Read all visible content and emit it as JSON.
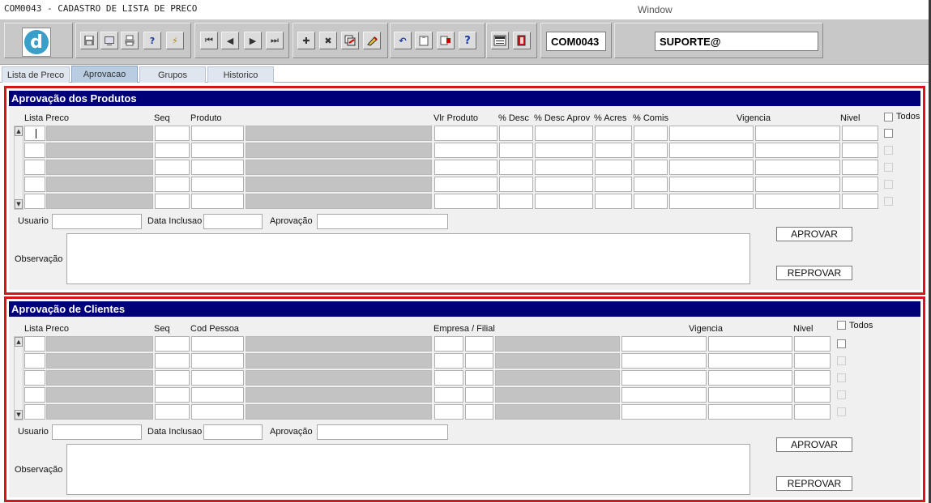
{
  "window": {
    "title": "COM0043 - CADASTRO DE LISTA DE PRECO",
    "menu_label": "Window"
  },
  "toolbar": {
    "logo_letter": "d",
    "form_code": "COM0043",
    "user": "SUPORTE@",
    "icons": [
      "save-icon",
      "screen-icon",
      "print-icon",
      "query-help-icon",
      "execute-query-icon",
      "first-record-icon",
      "previous-record-icon",
      "next-record-icon",
      "last-record-icon",
      "insert-record-icon",
      "delete-record-icon",
      "duplicate-record-icon",
      "clear-record-icon",
      "undo-icon",
      "clipboard-icon",
      "list-values-icon",
      "help-icon",
      "menu-icon",
      "exit-icon"
    ]
  },
  "tabs": [
    {
      "label": "Lista de Preco",
      "active": false
    },
    {
      "label": "Aprovacao",
      "active": true
    },
    {
      "label": "Grupos",
      "active": false
    },
    {
      "label": "Historico",
      "active": false
    }
  ],
  "produtos": {
    "title": "Aprovação dos Produtos",
    "columns": [
      "Lista Preco",
      "Seq",
      "Produto",
      "Vlr Produto",
      "% Desc",
      "% Desc Aprov",
      "% Acres",
      "% Comis",
      "Vigencia",
      "Nivel"
    ],
    "todos_label": "Todos",
    "usuario_label": "Usuario",
    "data_inclusao_label": "Data Inclusao",
    "aprovacao_label": "Aprovação",
    "observacao_label": "Observação",
    "aprovar_label": "APROVAR",
    "reprovar_label": "REPROVAR",
    "row_count": 5
  },
  "clientes": {
    "title": "Aprovação de Clientes",
    "columns": [
      "Lista Preco",
      "Seq",
      "Cod Pessoa",
      "Empresa / Filial",
      "Vigencia",
      "Nivel"
    ],
    "todos_label": "Todos",
    "usuario_label": "Usuario",
    "data_inclusao_label": "Data Inclusao",
    "aprovacao_label": "Aprovação",
    "observacao_label": "Observação",
    "aprovar_label": "APROVAR",
    "reprovar_label": "REPROVAR",
    "row_count": 5
  },
  "colors": {
    "section_header": "#000078",
    "highlight_border": "#d9141c",
    "active_tab": "#b9cde2"
  }
}
